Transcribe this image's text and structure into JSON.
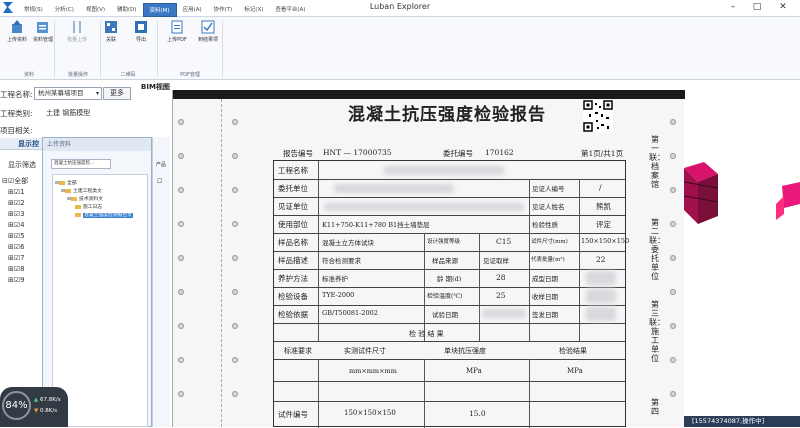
{
  "app": {
    "title": "Luban Explorer"
  },
  "menu": {
    "tabs": [
      "常规(S)",
      "分析(C)",
      "视图(V)",
      "辅助(D)",
      "资料(M)",
      "应用(A)",
      "协作(T)",
      "标记(X)",
      "查看平台(A)"
    ],
    "active_index": 4
  },
  "ribbon": {
    "buttons": [
      "上传资料",
      "资料管理",
      "批量上传",
      "关联",
      "导出",
      "上传PDF",
      "到结果项"
    ],
    "groups": [
      "资料",
      "批量操作",
      "二维码",
      "PDF管理"
    ]
  },
  "left_panel": {
    "project_label": "工程名称:",
    "project_value": "杭州某幕墙项目",
    "more_button": "更多",
    "engineering_category": "工程类别:",
    "engineering_value": "土建  钢筋模型",
    "project_related": "项目相关:",
    "tab_display": "显示控",
    "filter_label": "显示筛选",
    "tree_items": [
      "全部",
      "1",
      "2",
      "3",
      "4",
      "5",
      "6",
      "7",
      "8",
      "9"
    ]
  },
  "upload_dialog": {
    "title": "上传资料",
    "combo_value": "混凝土抗压强度检...",
    "tree": [
      {
        "label": "全部",
        "level": 0
      },
      {
        "label": "土建工程类文",
        "level": 1
      },
      {
        "label": "技术资料文",
        "level": 2
      },
      {
        "label": "施工日志",
        "level": 3
      },
      {
        "label": "混凝土强度检测报告文",
        "level": 3
      }
    ],
    "side_label": "产品"
  },
  "viewport": {
    "tab_label": "BIM视图"
  },
  "report": {
    "title": "混凝土抗压强度检验报告",
    "report_no_label": "报告编号",
    "report_no": "HNT  —  17000735",
    "commission_no_label": "委托编号",
    "commission_no": "170162",
    "page_info": "第1页/共1页",
    "rows": [
      {
        "label": "工程名称",
        "value": ""
      },
      {
        "label": "委托单位",
        "value": "",
        "right_label": "见证人编号",
        "right_value": "/"
      },
      {
        "label": "见证单位",
        "value": "",
        "right_label": "见证人姓名",
        "right_value": "熊凯"
      },
      {
        "label": "使用部位",
        "value": "K11+750-K11+780 B1挡土墙垫层",
        "right_label": "检验性质",
        "right_value": "评定"
      },
      {
        "label": "样品名称",
        "value": "混凝土立方体试块",
        "mid_label": "设计强度等级",
        "mid_value": "C15",
        "right_label": "试件尺寸(mm)",
        "right_value": "150×150×150"
      },
      {
        "label": "样品描述",
        "value": "符合检测要求",
        "mid_label": "样品来源",
        "mid_value": "见证取样",
        "right_label": "代表批量(m³)",
        "right_value": "22"
      },
      {
        "label": "养护方法",
        "value": "标准养护",
        "mid_label": "龄 期(d)",
        "mid_value": "28",
        "right_label": "成型日期",
        "right_value": ""
      },
      {
        "label": "检验设备",
        "value": "TYE-2000",
        "mid_label": "检验温度(℃)",
        "mid_value": "25",
        "right_label": "收样日期",
        "right_value": ""
      },
      {
        "label": "检验依据",
        "value": "GB/T50081-2002",
        "mid_label": "试验日期",
        "mid_value": "",
        "right_label": "签发日期",
        "right_value": ""
      }
    ],
    "results_title": "检  验  结  果",
    "col_headers": [
      "标准要求",
      "实测试件尺寸",
      "单块抗压强度",
      "检验结果"
    ],
    "units": [
      "mm×mm×mm",
      "MPa",
      "MPa"
    ],
    "specimen_label": "试件编号",
    "specimen_size": "150×150×150",
    "specimen_strength": "15.0",
    "side_stamps": [
      "第一联：档案馆",
      "第二联：委托单位",
      "第三联：施工单位",
      "第四"
    ]
  },
  "status": {
    "text": "[15574374087,操作中]"
  },
  "net_monitor": {
    "percent": "84%",
    "upload": "67.8K/s",
    "download": "0.8K/s"
  }
}
